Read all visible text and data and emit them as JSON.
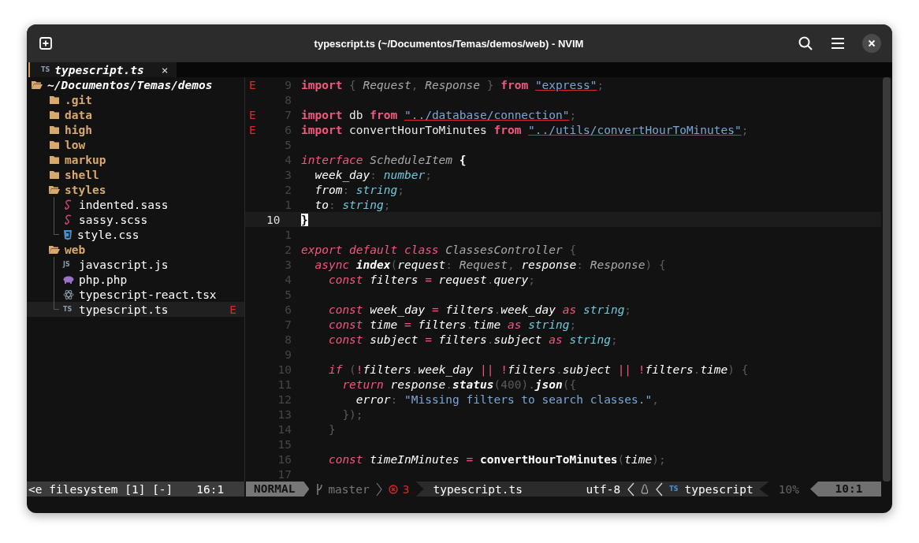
{
  "window": {
    "title": "typescript.ts (~/Documentos/Temas/demos/web) - NVIM"
  },
  "tabs": [
    {
      "badge": "TS",
      "label": "typescript.ts",
      "close": "×",
      "selected": true
    }
  ],
  "tree": {
    "root": {
      "label": "~/Documentos/Temas/demos",
      "expanded": true,
      "children": [
        {
          "label": ".git",
          "kind": "folder",
          "expanded": false,
          "selected": false
        },
        {
          "label": "data",
          "kind": "folder",
          "expanded": false,
          "selected": false
        },
        {
          "label": "high",
          "kind": "folder",
          "expanded": false,
          "selected": false
        },
        {
          "label": "low",
          "kind": "folder",
          "expanded": false,
          "selected": false
        },
        {
          "label": "markup",
          "kind": "folder",
          "expanded": false,
          "selected": false
        },
        {
          "label": "shell",
          "kind": "folder",
          "expanded": false,
          "selected": false
        },
        {
          "label": "styles",
          "kind": "folder",
          "expanded": true,
          "selected": false,
          "children": [
            {
              "label": "indented.sass",
              "kind": "sass",
              "selected": false
            },
            {
              "label": "sassy.scss",
              "kind": "sass",
              "selected": false
            },
            {
              "label": "style.css",
              "kind": "css",
              "selected": false
            }
          ]
        },
        {
          "label": "web",
          "kind": "folder",
          "expanded": true,
          "selected": false,
          "children": [
            {
              "label": "javascript.js",
              "kind": "js",
              "badge": "JS",
              "selected": false
            },
            {
              "label": "php.php",
              "kind": "php",
              "selected": false
            },
            {
              "label": "typescript-react.tsx",
              "kind": "react",
              "selected": false
            },
            {
              "label": "typescript.ts",
              "kind": "ts",
              "badge": "TS",
              "sign": "E",
              "selected": true
            }
          ]
        }
      ]
    }
  },
  "editor": {
    "lines": [
      {
        "sign": "E",
        "number": "9",
        "current": false,
        "tokens": [
          {
            "text": "import",
            "kind": "kw"
          },
          {
            "text": " { ",
            "kind": "pn"
          },
          {
            "text": "Request",
            "kind": "ty"
          },
          {
            "text": ", ",
            "kind": "pn"
          },
          {
            "text": "Response",
            "kind": "ty"
          },
          {
            "text": " } ",
            "kind": "pn"
          },
          {
            "text": "from ",
            "kind": "kw"
          },
          {
            "text": "\"express\"",
            "kind": "str"
          },
          {
            "text": ";",
            "kind": "pn"
          }
        ]
      },
      {
        "number": "8",
        "current": false
      },
      {
        "sign": "E",
        "number": "7",
        "current": false,
        "tokens": [
          {
            "text": "import",
            "kind": "kw"
          },
          {
            "text": " db ",
            "kind": "id"
          },
          {
            "text": "from ",
            "kind": "kw"
          },
          {
            "text": "\"../database/connection\"",
            "kind": "str"
          },
          {
            "text": ";",
            "kind": "pn"
          }
        ]
      },
      {
        "sign": "E",
        "number": "6",
        "current": false,
        "tokens": [
          {
            "text": "import",
            "kind": "kw"
          },
          {
            "text": " convertHourToMinutes ",
            "kind": "id"
          },
          {
            "text": "from ",
            "kind": "kw"
          },
          {
            "text": "\"../utils/convertHourToMinutes\"",
            "kind": "str"
          },
          {
            "text": ";",
            "kind": "pn"
          }
        ]
      },
      {
        "number": "5",
        "current": false
      },
      {
        "number": "4",
        "current": false,
        "tokens": [
          {
            "text": "interface",
            "kind": "kwi"
          },
          {
            "text": " ScheduleItem ",
            "kind": "ty"
          },
          {
            "text": "{",
            "kind": "fb"
          }
        ]
      },
      {
        "number": "3",
        "current": false,
        "tokens": [
          {
            "text": "  week_day",
            "kind": "var"
          },
          {
            "text": ": ",
            "kind": "pn"
          },
          {
            "text": "number",
            "kind": "bi"
          },
          {
            "text": ";",
            "kind": "pn"
          }
        ]
      },
      {
        "number": "2",
        "current": false,
        "tokens": [
          {
            "text": "  from",
            "kind": "var"
          },
          {
            "text": ": ",
            "kind": "pn"
          },
          {
            "text": "string",
            "kind": "bi"
          },
          {
            "text": ";",
            "kind": "pn"
          }
        ]
      },
      {
        "number": "1",
        "current": false,
        "tokens": [
          {
            "text": "  to",
            "kind": "var"
          },
          {
            "text": ": ",
            "kind": "pn"
          },
          {
            "text": "string",
            "kind": "bi"
          },
          {
            "text": ";",
            "kind": "pn"
          }
        ]
      },
      {
        "number": "10",
        "current": true,
        "tokens": [
          {
            "text": "}",
            "kind": "cur"
          }
        ]
      },
      {
        "number": "1",
        "current": false
      },
      {
        "number": "2",
        "current": false,
        "tokens": [
          {
            "text": "export default class",
            "kind": "kwi"
          },
          {
            "text": " ClassesController",
            "kind": "ty"
          },
          {
            "text": " {",
            "kind": "pn"
          }
        ]
      },
      {
        "number": "3",
        "current": false,
        "tokens": [
          {
            "text": "  async",
            "kind": "kwi"
          },
          {
            "text": " index",
            "kind": "fn"
          },
          {
            "text": "(",
            "kind": "pn"
          },
          {
            "text": "request",
            "kind": "var"
          },
          {
            "text": ": ",
            "kind": "pn"
          },
          {
            "text": "Request",
            "kind": "ty"
          },
          {
            "text": ", ",
            "kind": "pn"
          },
          {
            "text": "response",
            "kind": "var"
          },
          {
            "text": ": ",
            "kind": "pn"
          },
          {
            "text": "Response",
            "kind": "ty"
          },
          {
            "text": ") {",
            "kind": "pn"
          }
        ]
      },
      {
        "number": "4",
        "current": false,
        "tokens": [
          {
            "text": "    const",
            "kind": "kwi"
          },
          {
            "text": " filters ",
            "kind": "var"
          },
          {
            "text": "=",
            "kind": "op"
          },
          {
            "text": " request",
            "kind": "var"
          },
          {
            "text": ".",
            "kind": "pn"
          },
          {
            "text": "query",
            "kind": "var"
          },
          {
            "text": ";",
            "kind": "pn"
          }
        ]
      },
      {
        "number": "5",
        "current": false
      },
      {
        "number": "6",
        "current": false,
        "tokens": [
          {
            "text": "    const",
            "kind": "kwi"
          },
          {
            "text": " week_day ",
            "kind": "var"
          },
          {
            "text": "=",
            "kind": "op"
          },
          {
            "text": " filters",
            "kind": "var"
          },
          {
            "text": ".",
            "kind": "pn"
          },
          {
            "text": "week_day ",
            "kind": "var"
          },
          {
            "text": "as",
            "kind": "kwi"
          },
          {
            "text": " string",
            "kind": "bi"
          },
          {
            "text": ";",
            "kind": "pn"
          }
        ]
      },
      {
        "number": "7",
        "current": false,
        "tokens": [
          {
            "text": "    const",
            "kind": "kwi"
          },
          {
            "text": " time ",
            "kind": "var"
          },
          {
            "text": "=",
            "kind": "op"
          },
          {
            "text": " filters",
            "kind": "var"
          },
          {
            "text": ".",
            "kind": "pn"
          },
          {
            "text": "time ",
            "kind": "var"
          },
          {
            "text": "as",
            "kind": "kwi"
          },
          {
            "text": " string",
            "kind": "bi"
          },
          {
            "text": ";",
            "kind": "pn"
          }
        ]
      },
      {
        "number": "8",
        "current": false,
        "tokens": [
          {
            "text": "    const",
            "kind": "kwi"
          },
          {
            "text": " subject ",
            "kind": "var"
          },
          {
            "text": "=",
            "kind": "op"
          },
          {
            "text": " filters",
            "kind": "var"
          },
          {
            "text": ".",
            "kind": "pn"
          },
          {
            "text": "subject ",
            "kind": "var"
          },
          {
            "text": "as",
            "kind": "kwi"
          },
          {
            "text": " string",
            "kind": "bi"
          },
          {
            "text": ";",
            "kind": "pn"
          }
        ]
      },
      {
        "number": "9",
        "current": false
      },
      {
        "number": "10",
        "current": false,
        "tokens": [
          {
            "text": "    if",
            "kind": "kwi"
          },
          {
            "text": " (",
            "kind": "pn"
          },
          {
            "text": "!",
            "kind": "op"
          },
          {
            "text": "filters",
            "kind": "var"
          },
          {
            "text": ".",
            "kind": "pn"
          },
          {
            "text": "week_day ",
            "kind": "var"
          },
          {
            "text": "|| !",
            "kind": "op"
          },
          {
            "text": "filters",
            "kind": "var"
          },
          {
            "text": ".",
            "kind": "pn"
          },
          {
            "text": "subject ",
            "kind": "var"
          },
          {
            "text": "|| !",
            "kind": "op"
          },
          {
            "text": "filters",
            "kind": "var"
          },
          {
            "text": ".",
            "kind": "pn"
          },
          {
            "text": "time",
            "kind": "var"
          },
          {
            "text": ") {",
            "kind": "pn"
          }
        ]
      },
      {
        "number": "11",
        "current": false,
        "tokens": [
          {
            "text": "      return",
            "kind": "kwi"
          },
          {
            "text": " response",
            "kind": "var"
          },
          {
            "text": ".",
            "kind": "pn"
          },
          {
            "text": "status",
            "kind": "fn"
          },
          {
            "text": "(400)",
            "kind": "pn"
          },
          {
            "text": ".",
            "kind": "pn"
          },
          {
            "text": "json",
            "kind": "fn"
          },
          {
            "text": "({",
            "kind": "pn"
          }
        ]
      },
      {
        "number": "12",
        "current": false,
        "tokens": [
          {
            "text": "        error",
            "kind": "var"
          },
          {
            "text": ": ",
            "kind": "pn"
          },
          {
            "text": "\"Missing filters to search classes.\"",
            "kind": "s2"
          },
          {
            "text": ",",
            "kind": "pn"
          }
        ]
      },
      {
        "number": "13",
        "current": false,
        "tokens": [
          {
            "text": "      });",
            "kind": "pn"
          }
        ]
      },
      {
        "number": "14",
        "current": false,
        "tokens": [
          {
            "text": "    }",
            "kind": "pn"
          }
        ]
      },
      {
        "number": "15",
        "current": false
      },
      {
        "number": "16",
        "current": false,
        "tokens": [
          {
            "text": "    const",
            "kind": "kwi"
          },
          {
            "text": " timeInMinutes ",
            "kind": "var"
          },
          {
            "text": "= ",
            "kind": "op"
          },
          {
            "text": "convertHourToMinutes",
            "kind": "fb"
          },
          {
            "text": "(",
            "kind": "pn"
          },
          {
            "text": "time",
            "kind": "var"
          },
          {
            "text": ");",
            "kind": "pn"
          }
        ]
      },
      {
        "number": "17",
        "current": false
      }
    ]
  },
  "status_bar": {
    "explorer": {
      "label": "<e filesystem [1] [-]",
      "position": "16:1"
    },
    "mode": "NORMAL",
    "branch": "master",
    "errors": "3",
    "file": "typescript.ts",
    "encoding": "utf-8",
    "filetype_badge": "TS",
    "filetype": "typescript",
    "percent": "10%",
    "position": "10:1"
  }
}
